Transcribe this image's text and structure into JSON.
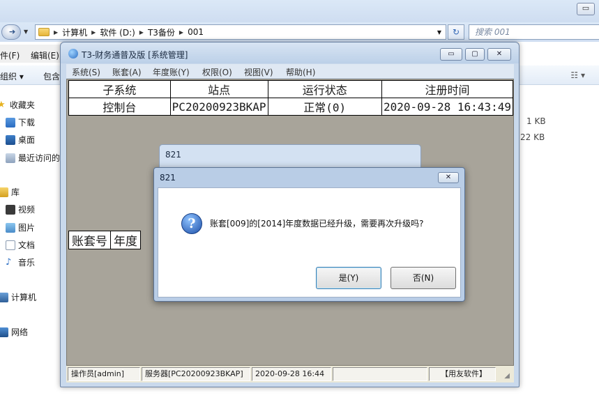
{
  "explorer": {
    "breadcrumbs": [
      "计算机",
      "软件 (D:)",
      "T3备份",
      "001"
    ],
    "search_placeholder": "搜索 001",
    "menu": [
      "件(F)",
      "编辑(E)"
    ],
    "toolbar": [
      "组织 ▾",
      "包含"
    ],
    "sidebar": {
      "favorites": "收藏夹",
      "downloads": "下载",
      "desktop": "桌面",
      "recent": "最近访问的",
      "libraries": "库",
      "videos": "视频",
      "pictures": "图片",
      "documents": "文档",
      "music": "音乐",
      "computer": "计算机",
      "network": "网络"
    },
    "file_sizes": [
      "1 KB",
      "22 KB"
    ]
  },
  "app": {
    "title": "T3-财务通普及版 [系统管理]",
    "menu": [
      "系统(S)",
      "账套(A)",
      "年度账(Y)",
      "权限(O)",
      "视图(V)",
      "帮助(H)"
    ],
    "grid1": {
      "headers": [
        "子系统",
        "站点",
        "运行状态",
        "注册时间"
      ],
      "row": [
        "控制台",
        "PC20200923BKAP",
        "正常(0)",
        "2020-09-28 16:43:49"
      ]
    },
    "grid2": {
      "headers": [
        "账套号",
        "年度"
      ]
    },
    "status": {
      "operator": "操作员[admin]",
      "server": "服务器[PC20200923BKAP]",
      "datetime": "2020-09-28 16:44",
      "empty": "",
      "brand": "【用友软件】"
    }
  },
  "bg_dialog": {
    "title": "821"
  },
  "dialog": {
    "title": "821",
    "message": "账套[009]的[2014]年度数据已经升级，需要再次升级吗?",
    "yes_label": "是(Y)",
    "no_label": "否(N)"
  }
}
